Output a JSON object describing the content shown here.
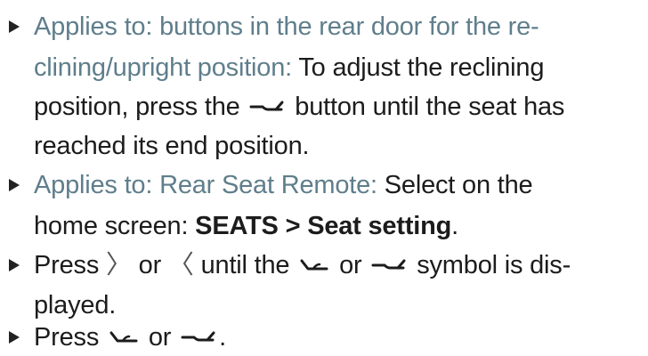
{
  "items": [
    {
      "applies_1": "Applies to: buttons in the rear door for the re-",
      "applies_2": "clining/upright position:",
      "text_2": "To adjust the reclining",
      "text_3a": "position, press the",
      "text_3b": "button until the seat has",
      "text_4": "reached its end position."
    },
    {
      "applies": "Applies to: Rear Seat Remote:",
      "text_1": "Select on the",
      "text_2a": "home screen:",
      "bold_1": "SEATS",
      "sep": ">",
      "bold_2": "Seat setting",
      "end": "."
    },
    {
      "text_1a": "Press",
      "chev_right": "〉",
      "text_1b": "or",
      "chev_left": "〈",
      "text_1c": "until the",
      "text_1d": "or",
      "text_1e": "symbol is dis-",
      "text_2": "played."
    },
    {
      "text_1a": "Press",
      "text_1b": "or",
      "end": "."
    }
  ],
  "icons": {
    "upright": "seat-upright-icon",
    "recline": "seat-recline-icon"
  }
}
